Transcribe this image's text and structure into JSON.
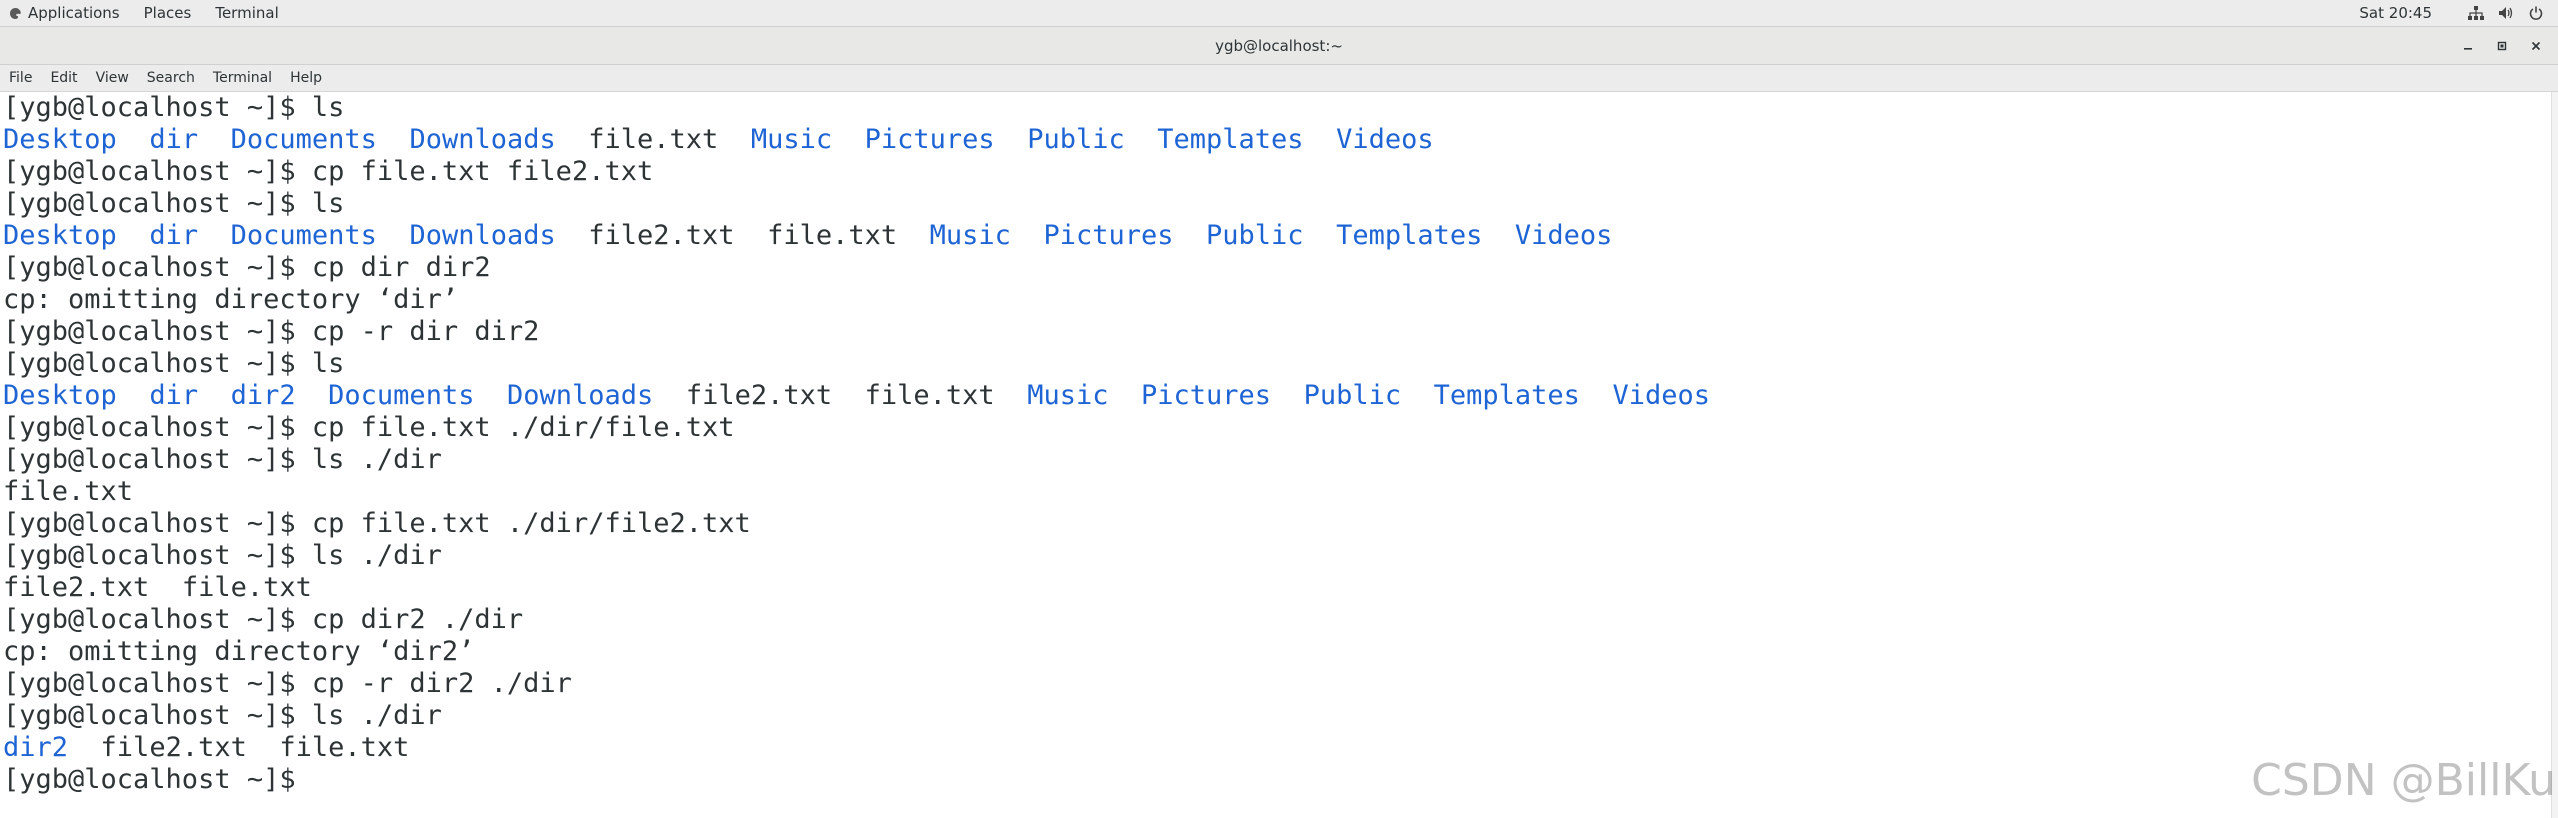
{
  "topbar": {
    "applications": "Applications",
    "places": "Places",
    "terminal": "Terminal",
    "clock": "Sat 20:45"
  },
  "window": {
    "title": "ygb@localhost:~"
  },
  "menubar": [
    "File",
    "Edit",
    "View",
    "Search",
    "Terminal",
    "Help"
  ],
  "terminal_lines": [
    [
      {
        "t": "[ygb@localhost ~]$ ls",
        "k": "text"
      }
    ],
    [
      {
        "t": "Desktop",
        "k": "dir"
      },
      {
        "t": "  ",
        "k": "sep"
      },
      {
        "t": "dir",
        "k": "dir"
      },
      {
        "t": "  ",
        "k": "sep"
      },
      {
        "t": "Documents",
        "k": "dir"
      },
      {
        "t": "  ",
        "k": "sep"
      },
      {
        "t": "Downloads",
        "k": "dir"
      },
      {
        "t": "  ",
        "k": "sep"
      },
      {
        "t": "file.txt",
        "k": "file"
      },
      {
        "t": "  ",
        "k": "sep"
      },
      {
        "t": "Music",
        "k": "dir"
      },
      {
        "t": "  ",
        "k": "sep"
      },
      {
        "t": "Pictures",
        "k": "dir"
      },
      {
        "t": "  ",
        "k": "sep"
      },
      {
        "t": "Public",
        "k": "dir"
      },
      {
        "t": "  ",
        "k": "sep"
      },
      {
        "t": "Templates",
        "k": "dir"
      },
      {
        "t": "  ",
        "k": "sep"
      },
      {
        "t": "Videos",
        "k": "dir"
      }
    ],
    [
      {
        "t": "[ygb@localhost ~]$ cp file.txt file2.txt",
        "k": "text"
      }
    ],
    [
      {
        "t": "[ygb@localhost ~]$ ls",
        "k": "text"
      }
    ],
    [
      {
        "t": "Desktop",
        "k": "dir"
      },
      {
        "t": "  ",
        "k": "sep"
      },
      {
        "t": "dir",
        "k": "dir"
      },
      {
        "t": "  ",
        "k": "sep"
      },
      {
        "t": "Documents",
        "k": "dir"
      },
      {
        "t": "  ",
        "k": "sep"
      },
      {
        "t": "Downloads",
        "k": "dir"
      },
      {
        "t": "  ",
        "k": "sep"
      },
      {
        "t": "file2.txt",
        "k": "file"
      },
      {
        "t": "  ",
        "k": "sep"
      },
      {
        "t": "file.txt",
        "k": "file"
      },
      {
        "t": "  ",
        "k": "sep"
      },
      {
        "t": "Music",
        "k": "dir"
      },
      {
        "t": "  ",
        "k": "sep"
      },
      {
        "t": "Pictures",
        "k": "dir"
      },
      {
        "t": "  ",
        "k": "sep"
      },
      {
        "t": "Public",
        "k": "dir"
      },
      {
        "t": "  ",
        "k": "sep"
      },
      {
        "t": "Templates",
        "k": "dir"
      },
      {
        "t": "  ",
        "k": "sep"
      },
      {
        "t": "Videos",
        "k": "dir"
      }
    ],
    [
      {
        "t": "[ygb@localhost ~]$ cp dir dir2",
        "k": "text"
      }
    ],
    [
      {
        "t": "cp: omitting directory ‘dir’",
        "k": "text"
      }
    ],
    [
      {
        "t": "[ygb@localhost ~]$ cp -r dir dir2",
        "k": "text"
      }
    ],
    [
      {
        "t": "[ygb@localhost ~]$ ls",
        "k": "text"
      }
    ],
    [
      {
        "t": "Desktop",
        "k": "dir"
      },
      {
        "t": "  ",
        "k": "sep"
      },
      {
        "t": "dir",
        "k": "dir"
      },
      {
        "t": "  ",
        "k": "sep"
      },
      {
        "t": "dir2",
        "k": "dir"
      },
      {
        "t": "  ",
        "k": "sep"
      },
      {
        "t": "Documents",
        "k": "dir"
      },
      {
        "t": "  ",
        "k": "sep"
      },
      {
        "t": "Downloads",
        "k": "dir"
      },
      {
        "t": "  ",
        "k": "sep"
      },
      {
        "t": "file2.txt",
        "k": "file"
      },
      {
        "t": "  ",
        "k": "sep"
      },
      {
        "t": "file.txt",
        "k": "file"
      },
      {
        "t": "  ",
        "k": "sep"
      },
      {
        "t": "Music",
        "k": "dir"
      },
      {
        "t": "  ",
        "k": "sep"
      },
      {
        "t": "Pictures",
        "k": "dir"
      },
      {
        "t": "  ",
        "k": "sep"
      },
      {
        "t": "Public",
        "k": "dir"
      },
      {
        "t": "  ",
        "k": "sep"
      },
      {
        "t": "Templates",
        "k": "dir"
      },
      {
        "t": "  ",
        "k": "sep"
      },
      {
        "t": "Videos",
        "k": "dir"
      }
    ],
    [
      {
        "t": "[ygb@localhost ~]$ cp file.txt ./dir/file.txt",
        "k": "text"
      }
    ],
    [
      {
        "t": "[ygb@localhost ~]$ ls ./dir",
        "k": "text"
      }
    ],
    [
      {
        "t": "file.txt",
        "k": "file"
      }
    ],
    [
      {
        "t": "[ygb@localhost ~]$ cp file.txt ./dir/file2.txt",
        "k": "text"
      }
    ],
    [
      {
        "t": "[ygb@localhost ~]$ ls ./dir",
        "k": "text"
      }
    ],
    [
      {
        "t": "file2.txt",
        "k": "file"
      },
      {
        "t": "  ",
        "k": "sep"
      },
      {
        "t": "file.txt",
        "k": "file"
      }
    ],
    [
      {
        "t": "[ygb@localhost ~]$ cp dir2 ./dir",
        "k": "text"
      }
    ],
    [
      {
        "t": "cp: omitting directory ‘dir2’",
        "k": "text"
      }
    ],
    [
      {
        "t": "[ygb@localhost ~]$ cp -r dir2 ./dir",
        "k": "text"
      }
    ],
    [
      {
        "t": "[ygb@localhost ~]$ ls ./dir",
        "k": "text"
      }
    ],
    [
      {
        "t": "dir2",
        "k": "dir"
      },
      {
        "t": "  ",
        "k": "sep"
      },
      {
        "t": "file2.txt",
        "k": "file"
      },
      {
        "t": "  ",
        "k": "sep"
      },
      {
        "t": "file.txt",
        "k": "file"
      }
    ],
    [
      {
        "t": "[ygb@localhost ~]$ ",
        "k": "text"
      }
    ]
  ],
  "watermark": "CSDN @BillKu",
  "colors": {
    "directory": "#1e64d4",
    "text": "#2e3436",
    "background": "#ffffff"
  },
  "icons": {
    "apps": "apps-icon",
    "network": "network-icon",
    "volume": "volume-icon",
    "power": "power-icon",
    "minimize": "minimize-icon",
    "maximize": "maximize-icon",
    "close": "close-icon"
  }
}
